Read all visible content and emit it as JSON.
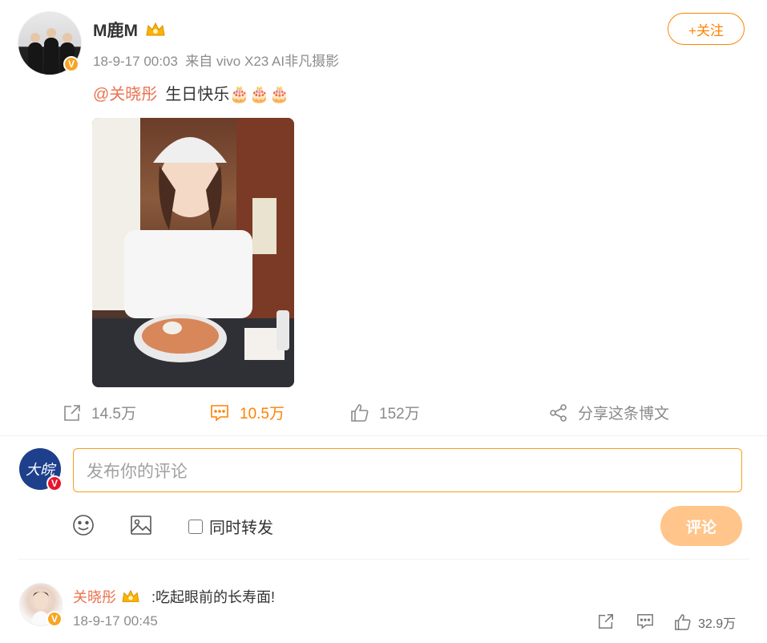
{
  "post": {
    "username": "M鹿M",
    "meta": "18-9-17 00:03  来自 vivo X23 AI非凡摄影",
    "follow_label": "+关注",
    "mention": "@关晓彤",
    "text": "生日快乐🎂🎂🎂"
  },
  "actions": {
    "repost": "14.5万",
    "comment": "10.5万",
    "like": "152万",
    "share": "分享这条博文"
  },
  "composer": {
    "placeholder": "发布你的评论",
    "repost_checkbox_label": "同时转发",
    "submit_label": "评论"
  },
  "comment": {
    "username": "关晓彤",
    "text": ":吃起眼前的长寿面!",
    "time": "18-9-17 00:45",
    "likes": "32.9万"
  },
  "colors": {
    "accent": "#ff8200",
    "name_color": "#eb7350",
    "submit_disabled": "#ffc58a"
  }
}
